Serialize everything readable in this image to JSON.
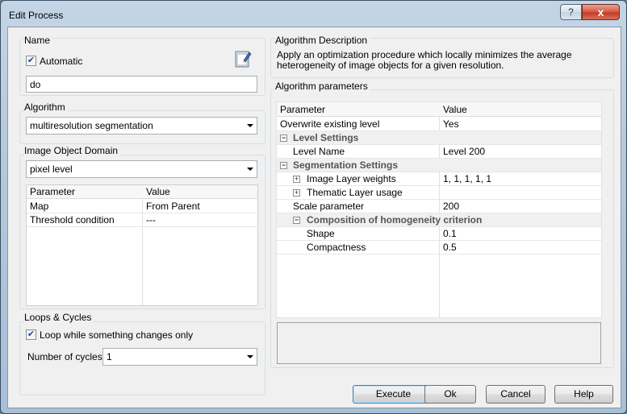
{
  "window": {
    "title": "Edit Process",
    "help_glyph": "?",
    "close_glyph": "x"
  },
  "name_group": {
    "title": "Name",
    "automatic_label": "Automatic",
    "automatic_checked": true,
    "name_value": "do"
  },
  "algorithm_group": {
    "title": "Algorithm",
    "selected": "multiresolution segmentation"
  },
  "domain_group": {
    "title": "Image Object Domain",
    "selected": "pixel level",
    "columns": [
      "Parameter",
      "Value"
    ],
    "rows": [
      {
        "param": "Map",
        "value": "From Parent"
      },
      {
        "param": "Threshold condition",
        "value": "---"
      }
    ]
  },
  "loops_group": {
    "title": "Loops & Cycles",
    "loop_label": "Loop while something changes only",
    "loop_checked": true,
    "cycles_label": "Number of cycles",
    "cycles_value": "1"
  },
  "description": {
    "title": "Algorithm Description",
    "text": "Apply an optimization procedure which locally minimizes the average heterogeneity of image objects for a given resolution."
  },
  "parameters": {
    "title": "Algorithm parameters",
    "columns": [
      "Parameter",
      "Value"
    ],
    "overwrite": {
      "param": "Overwrite existing level",
      "value": "Yes"
    },
    "level_settings": "Level Settings",
    "level_name": {
      "param": "Level Name",
      "value": "Level 200"
    },
    "segmentation_settings": "Segmentation Settings",
    "image_layer_weights": {
      "param": "Image Layer weights",
      "value": "1, 1, 1, 1, 1"
    },
    "thematic_layer_usage": {
      "param": "Thematic Layer usage",
      "value": ""
    },
    "scale_parameter": {
      "param": "Scale parameter",
      "value": "200"
    },
    "composition": "Composition of homogeneity criterion",
    "shape": {
      "param": "Shape",
      "value": "0.1"
    },
    "compactness": {
      "param": "Compactness",
      "value": "0.5"
    },
    "expand_glyph": "+",
    "collapse_glyph": "−"
  },
  "buttons": {
    "execute": "Execute",
    "ok": "Ok",
    "cancel": "Cancel",
    "help": "Help"
  }
}
